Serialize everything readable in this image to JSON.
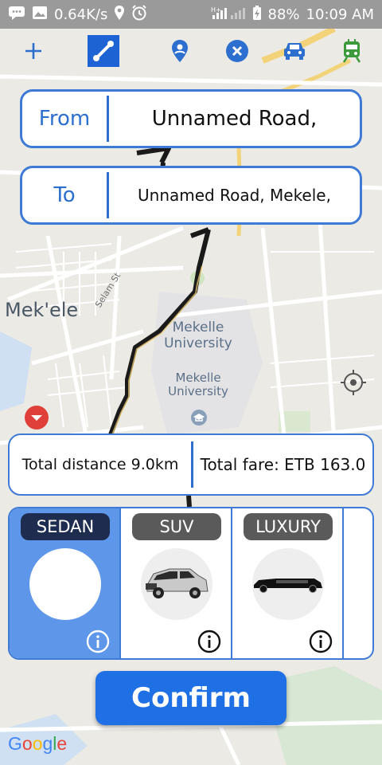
{
  "status_bar": {
    "speed": "0.64K/s",
    "network": "H+",
    "battery": "88%",
    "time": "10:09 AM"
  },
  "toolbar": {
    "icons": [
      "add-icon",
      "route-icon",
      "place-pin-icon",
      "cancel-icon",
      "car-icon",
      "train-icon"
    ]
  },
  "route": {
    "from_label": "From",
    "from_value": "Unnamed Road,",
    "to_label": "To",
    "to_value": "Unnamed Road, Mekele,"
  },
  "map": {
    "city_label": "Mek'ele",
    "university_label": "Mekelle University",
    "university_label_2": "Mekelle University",
    "street_label": "Selam St",
    "attribution": "Google"
  },
  "trip": {
    "distance_text": "Total distance 9.0km",
    "fare_text": "Total fare: ETB 163.0"
  },
  "vehicles": [
    {
      "name": "SEDAN",
      "selected": true
    },
    {
      "name": "SUV",
      "selected": false
    },
    {
      "name": "LUXURY",
      "selected": false
    }
  ],
  "actions": {
    "confirm_label": "Confirm"
  },
  "colors": {
    "accent": "#2d6fcf",
    "confirm_button": "#1f6fe5",
    "selected_vehicle": "#5e97ea",
    "route_line": "#1a1a1a"
  }
}
